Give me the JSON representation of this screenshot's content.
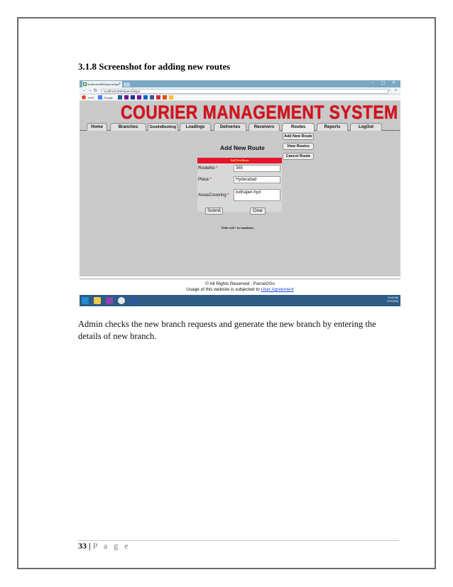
{
  "document": {
    "section_heading": "3.1.8 Screenshot for adding new routes",
    "caption": "Admin checks the new branch requests and generate the new branch by entering the details of new branch.",
    "footer": {
      "page_number": "33",
      "separator": "|",
      "page_word": "P a g e"
    }
  },
  "screenshot": {
    "browser": {
      "tab_title": "localhost:8084/parcel2go/",
      "tab_close": "×",
      "url": "localhost:8084/parcel2go/",
      "window_controls": "– ▢ ✕",
      "bookmarks": [
        "AHS",
        "Google"
      ]
    },
    "app": {
      "banner_title": "COURIER MANAGEMENT SYSTEM",
      "menu": [
        "Home",
        "Branches",
        "GoodsBooking",
        "Loadings",
        "Deliveries",
        "Receivers",
        "Routes",
        "Reports",
        "LogOut"
      ],
      "active_menu": "Routes",
      "submenu": [
        "Add New Route",
        "View Routes",
        "Cancel Route"
      ],
      "form_title": "Add New Route",
      "form_header": "Add NewRoute",
      "fields": [
        {
          "label": "RouteNo",
          "value": "365"
        },
        {
          "label": "Place",
          "value": "Hyderabad"
        },
        {
          "label": "AreasCovering",
          "value": "kothaper-hyd"
        }
      ],
      "required_marker": "*",
      "submit_label": "Submit",
      "clear_label": "Clear",
      "mandatory_note": "Fields with * are mandatory"
    },
    "footer": {
      "copyright": "© All Rights Reserved , Parcel2Go",
      "usage_prefix": "Usage of this website is subjected to ",
      "usage_link": "User Agreement"
    },
    "taskbar": {
      "time": "10:40 AM",
      "date": "4/19/2016"
    }
  }
}
